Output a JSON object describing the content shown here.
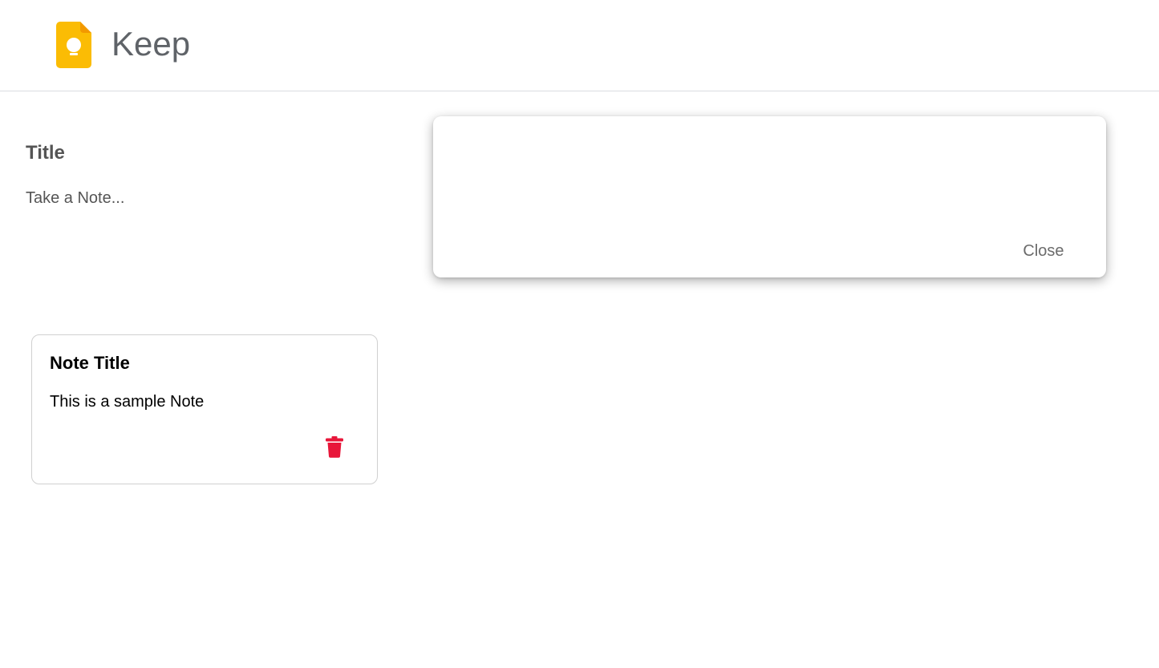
{
  "header": {
    "app_title": "Keep",
    "logo_icon": "keep-lightbulb-icon",
    "logo_color": "#FBBC04"
  },
  "composer": {
    "title_placeholder": "Title",
    "body_placeholder": "Take a Note...",
    "close_label": "Close"
  },
  "notes": [
    {
      "title": "Note Title",
      "content": "This is a sample Note",
      "delete_icon": "trash-icon",
      "delete_color": "#E8173A"
    }
  ]
}
